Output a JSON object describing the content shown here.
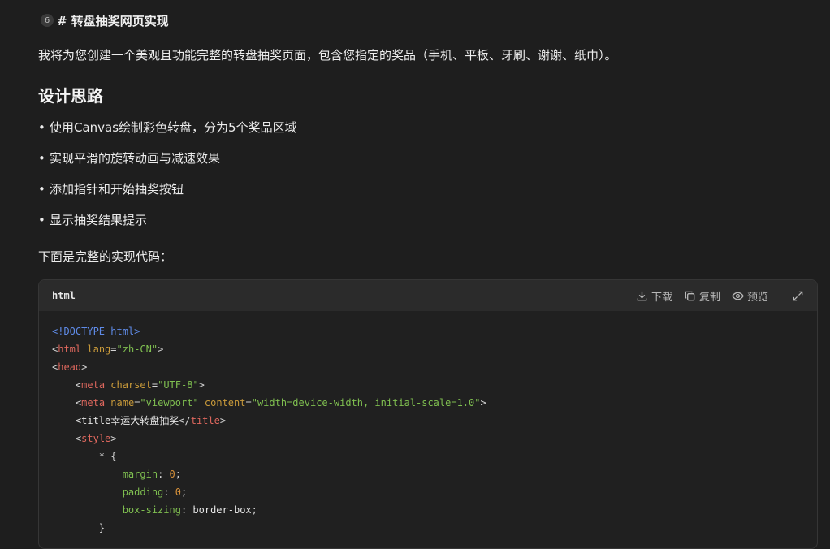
{
  "heading": {
    "step": "6",
    "text": "# 转盘抽奖网页实现"
  },
  "intro": "我将为您创建一个美观且功能完整的转盘抽奖页面，包含您指定的奖品（手机、平板、牙刷、谢谢、纸巾）。",
  "design_title": "设计思路",
  "bullets": [
    "使用Canvas绘制彩色转盘，分为5个奖品区域",
    "实现平滑的旋转动画与减速效果",
    "添加指针和开始抽奖按钮",
    "显示抽奖结果提示"
  ],
  "below_text": "下面是完整的实现代码：",
  "code_block": {
    "language": "html",
    "actions": {
      "download": "下载",
      "copy": "复制",
      "preview": "预览"
    },
    "lines": {
      "l1": [
        "<!DOCTYPE ",
        "html",
        ">"
      ],
      "l2": [
        "<",
        "html",
        " ",
        "lang",
        "=",
        "\"zh-CN\"",
        ">"
      ],
      "l3": [
        "<",
        "head",
        ">"
      ],
      "l4": [
        "<",
        "meta",
        " ",
        "charset",
        "=",
        "\"UTF-8\"",
        ">"
      ],
      "l5": [
        "<",
        "meta",
        " ",
        "name",
        "=",
        "\"viewport\"",
        " ",
        "content",
        "=",
        "\"width=device-width, initial-scale=1.0\"",
        ">"
      ],
      "l6": [
        "<title",
        "幸运大转盘抽奖",
        "</",
        "title",
        ">"
      ],
      "l7": [
        "<",
        "style",
        ">"
      ],
      "l8": [
        "* {"
      ],
      "l9": [
        "margin",
        ": ",
        "0",
        ";"
      ],
      "l10": [
        "padding",
        ": ",
        "0",
        ";"
      ],
      "l11": [
        "box-sizing",
        ": ",
        "border-box",
        ";"
      ],
      "l12": [
        "}"
      ]
    }
  }
}
